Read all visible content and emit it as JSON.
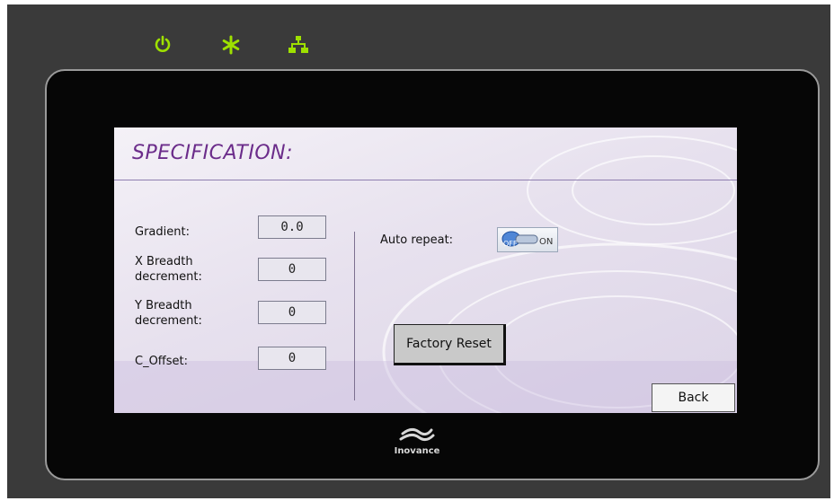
{
  "device": {
    "indicators": [
      {
        "icon": "power-icon",
        "color": "#9ee000"
      },
      {
        "icon": "run-asterisk-icon",
        "color": "#9ee000"
      },
      {
        "icon": "network-icon",
        "color": "#9ee000"
      }
    ],
    "logo_text": "Inovance"
  },
  "screen": {
    "title": "SPECIFICATION:",
    "accent_color": "#6b2c8a",
    "fields": [
      {
        "label": "Gradient:",
        "value": "0.0"
      },
      {
        "label": "X Breadth decrement:",
        "value": "0"
      },
      {
        "label": "Y Breadth decrement:",
        "value": "0"
      },
      {
        "label": "C_Offset:",
        "value": "0"
      }
    ],
    "auto_repeat": {
      "label": "Auto repeat:",
      "state": "OFF",
      "off_text": "OFF",
      "on_text": "ON"
    },
    "factory_reset_label": "Factory Reset",
    "back_label": "Back"
  }
}
